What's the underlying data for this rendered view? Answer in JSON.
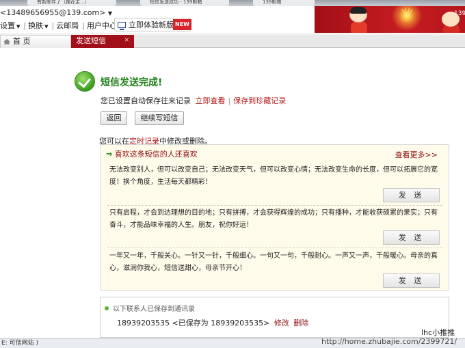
{
  "browser_tabs": [
    {
      "label": "有新邮件了（推荐主…）"
    },
    {
      "label": "短信发送成功 - 139邮箱"
    },
    {
      "label": "139邮箱"
    }
  ],
  "header": {
    "account": "<13489656955@139.com>",
    "links": [
      "设置",
      "换肤",
      "云邮局",
      "用户中心"
    ],
    "try_new_label": "立即体验新版",
    "new_badge": "NEW",
    "phone_right": "139"
  },
  "tabs": {
    "home": "首 页",
    "current": "发送短信",
    "close": "×"
  },
  "result": {
    "title": "短信发送完成!",
    "saved_prefix": "您已设置自动保存往来记录",
    "view_now": "立即查看",
    "save_treasure": "保存到珍藏记录",
    "back_button": "返回",
    "continue_button": "继续写短信",
    "timed_prefix": "您可以在",
    "timed_link": "定时记录",
    "timed_suffix": "中修改或删除。"
  },
  "recommend": {
    "heading": "喜欢这条短信的人还喜欢",
    "more": "查看更多>>",
    "send_label": "发 送",
    "items": [
      {
        "text": "无法改变别人，但可以改变自己；无法改变天气，但可以改变心情；无法改变生命的长度，但可以拓展它的宽度！换个角度，生活每天都精彩！"
      },
      {
        "text": "只有启程，才会到达理想的目的地；只有拼搏，才会获得辉煌的成功；只有播种，才能收获硕累的果实；只有奋斗，才能品味幸福的人生。朋友，祝你好运！"
      },
      {
        "text": "一年又一年，千般关心。一针又一针，千般细心。一句又一句，千般耐心。一声又一声，千般暖心。母亲的真心，滋润你我心，短信送甜心，母亲节开心！"
      }
    ]
  },
  "contacts": {
    "heading": "以下联系人已保存到通讯录",
    "line": "18939203535 <已保存为 18939203535>",
    "edit": "修改",
    "delete": "删除"
  },
  "statusbar": {
    "text": "E: 可信网站 )"
  },
  "watermark": {
    "name": "lhc小推推",
    "url": "http://home.zhubajie.com/2399721/"
  }
}
